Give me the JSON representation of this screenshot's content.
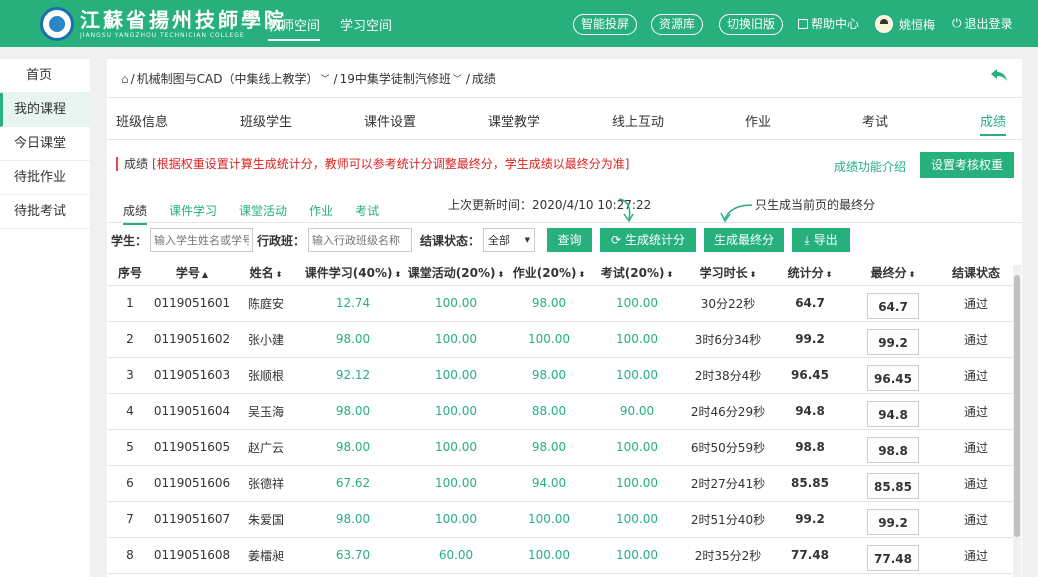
{
  "header": {
    "logo_cn": "江蘇省揚州技師學院",
    "logo_en": "JIANGSU YANGZHOU TECHNICIAN COLLEGE",
    "nav": [
      {
        "label": "教师空间",
        "active": true
      },
      {
        "label": "学习空间",
        "active": false
      }
    ],
    "buttons": [
      "智能投屏",
      "资源库",
      "切换旧版"
    ],
    "help": "帮助中心",
    "user": "姚恒梅",
    "logout": "退出登录"
  },
  "sidebar": {
    "items": [
      {
        "label": "首页",
        "active": false
      },
      {
        "label": "我的课程",
        "active": true
      },
      {
        "label": "今日课堂",
        "active": false
      },
      {
        "label": "待批作业",
        "active": false
      },
      {
        "label": "待批考试",
        "active": false
      }
    ]
  },
  "breadcrumb": {
    "course": "机械制图与CAD（中集线上教学）",
    "class": "19中集学徒制汽修班",
    "current": "成绩"
  },
  "tabs": [
    "班级信息",
    "班级学生",
    "课件设置",
    "课堂教学",
    "线上互动",
    "作业",
    "考试",
    "成绩"
  ],
  "notice": {
    "title": "成绩",
    "text": "[根据权重设置计算生成统计分，教师可以参考统计分调整最终分，学生成绩以最终分为准]",
    "func_link": "成绩功能介绍",
    "set_weight": "设置考核权重"
  },
  "subtabs": [
    "成绩",
    "课件学习",
    "课堂活动",
    "作业",
    "考试"
  ],
  "update_time": "上次更新时间：2020/4/10 10:27:22",
  "hint": "只生成当前页的最终分",
  "filters": {
    "student_label": "学生：",
    "student_placeholder": "输入学生姓名或学号",
    "class_label": "行政班：",
    "class_placeholder": "输入行政班级名称",
    "status_label": "结课状态：",
    "status_value": "全部",
    "query": "查询",
    "gen_stat": "生成统计分",
    "gen_final": "生成最终分",
    "export": "导出"
  },
  "table": {
    "columns": [
      "序号",
      "学号",
      "姓名",
      "课件学习(40%)",
      "课堂活动(20%)",
      "作业(20%)",
      "考试(20%)",
      "学习时长",
      "统计分",
      "最终分",
      "结课状态"
    ],
    "rows": [
      [
        "1",
        "0119051601",
        "陈庭安",
        "12.74",
        "100.00",
        "98.00",
        "100.00",
        "30分22秒",
        "64.7",
        "64.7",
        "通过"
      ],
      [
        "2",
        "0119051602",
        "张小建",
        "98.00",
        "100.00",
        "100.00",
        "100.00",
        "3时6分34秒",
        "99.2",
        "99.2",
        "通过"
      ],
      [
        "3",
        "0119051603",
        "张顺根",
        "92.12",
        "100.00",
        "98.00",
        "100.00",
        "2时38分4秒",
        "96.45",
        "96.45",
        "通过"
      ],
      [
        "4",
        "0119051604",
        "吴玉海",
        "98.00",
        "100.00",
        "88.00",
        "90.00",
        "2时46分29秒",
        "94.8",
        "94.8",
        "通过"
      ],
      [
        "5",
        "0119051605",
        "赵广云",
        "98.00",
        "100.00",
        "98.00",
        "100.00",
        "6时50分59秒",
        "98.8",
        "98.8",
        "通过"
      ],
      [
        "6",
        "0119051606",
        "张德祥",
        "67.62",
        "100.00",
        "94.00",
        "100.00",
        "2时27分41秒",
        "85.85",
        "85.85",
        "通过"
      ],
      [
        "7",
        "0119051607",
        "朱爱国",
        "98.00",
        "100.00",
        "100.00",
        "100.00",
        "2时51分40秒",
        "99.2",
        "99.2",
        "通过"
      ],
      [
        "8",
        "0119051608",
        "姜檑昶",
        "63.70",
        "60.00",
        "100.00",
        "100.00",
        "2时35分2秒",
        "77.48",
        "77.48",
        "通过"
      ]
    ]
  },
  "colors": {
    "accent": "#27b07c",
    "notice": "#e02020"
  }
}
